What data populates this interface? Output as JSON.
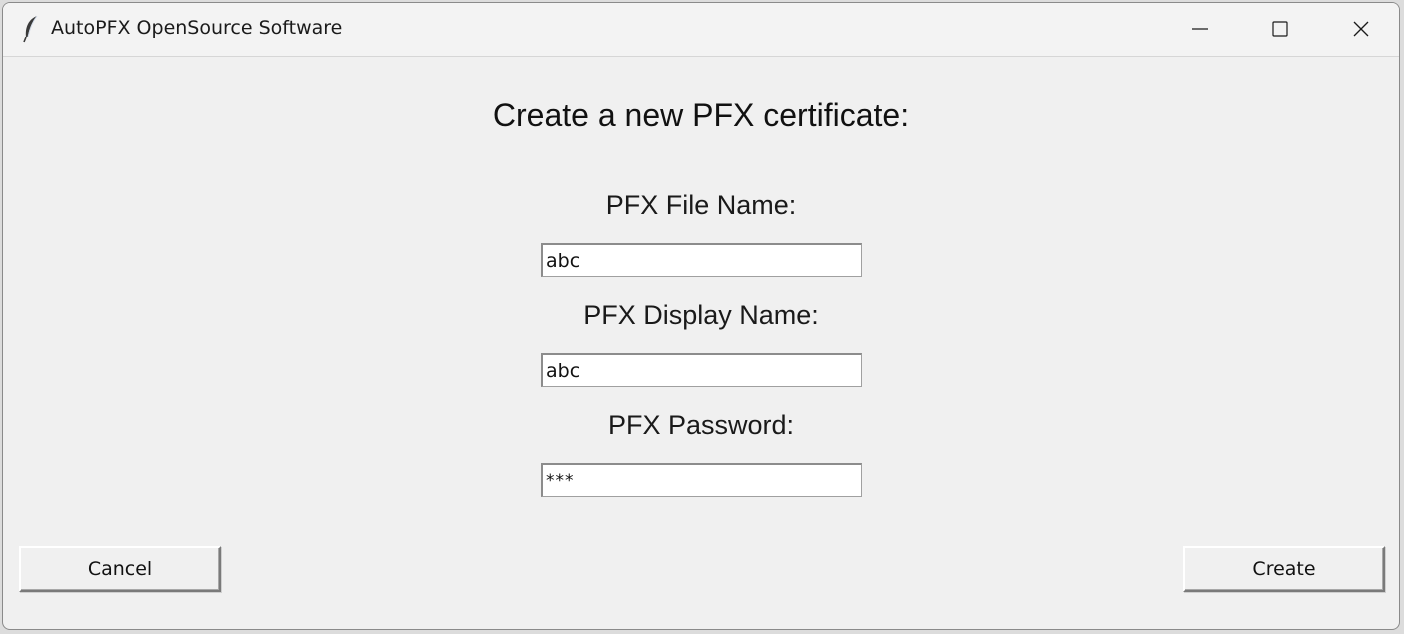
{
  "window": {
    "title": "AutoPFX OpenSource Software",
    "icons": [
      "feather-icon",
      "minimize-icon",
      "maximize-icon",
      "close-icon"
    ]
  },
  "form": {
    "heading": "Create a new PFX certificate:",
    "file_name_label": "PFX File Name:",
    "file_name_value": "abc",
    "display_name_label": "PFX Display Name:",
    "display_name_value": "abc",
    "password_label": "PFX Password:",
    "password_value": "***"
  },
  "buttons": {
    "cancel_label": "Cancel",
    "create_label": "Create"
  },
  "colors": {
    "window_background": "#f0f0f0",
    "input_background": "#ffffff"
  }
}
